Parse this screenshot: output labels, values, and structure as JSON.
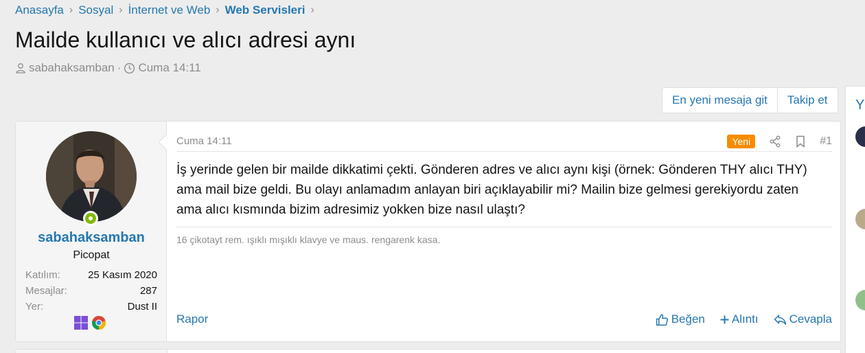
{
  "breadcrumb": {
    "items": [
      "Anasayfa",
      "Sosyal",
      "İnternet ve Web",
      "Web Servisleri"
    ]
  },
  "thread": {
    "title": "Mailde kullanıcı ve alıcı adresi aynı",
    "author": "sabahaksamban",
    "separator": "·",
    "time": "Cuma 14:11"
  },
  "buttons": {
    "latest": "En yeni mesaja git",
    "follow": "Takip et"
  },
  "side": {
    "title_fragment": "Y"
  },
  "post": {
    "user": {
      "name": "sabahaksamban",
      "title": "Picopat",
      "stats": [
        {
          "label": "Katılım:",
          "value": "25 Kasım 2020"
        },
        {
          "label": "Mesajlar:",
          "value": "287"
        },
        {
          "label": "Yer:",
          "value": "Dust II"
        }
      ],
      "badges": [
        "windows-icon",
        "chrome-icon"
      ]
    },
    "date": "Cuma 14:11",
    "new_badge": "Yeni",
    "number": "#1",
    "body": "İş yerinde gelen bir mailde dikkatimi çekti. Gönderen adres ve alıcı aynı kişi (örnek: Gönderen THY alıcı THY) ama mail bize geldi. Bu olayı anlamadım anlayan biri açıklayabilir mi? Mailin bize gelmesi gerekiyordu zaten ama alıcı kısmında bizim adresimiz yokken bize nasıl ulaştı?",
    "signature": "16 çikotayt rem. ışıklı mışıklı klavye ve maus. rengarenk kasa.",
    "report": "Rapor",
    "like": "Beğen",
    "quote": "Alıntı",
    "reply": "Cevapla"
  },
  "colors": {
    "link": "#2577b1",
    "new_badge": "#f78c00",
    "online": "#7fb900",
    "background": "#ededed"
  }
}
